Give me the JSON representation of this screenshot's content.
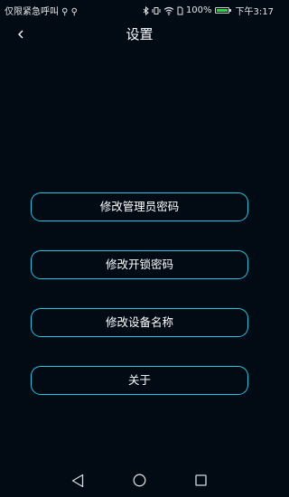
{
  "status_bar": {
    "left_text": "仅限紧急呼叫 ⚲ ⚲",
    "bluetooth_icon": "bluetooth-icon",
    "vibrate_icon": "vibrate-icon",
    "wifi_icon": "wifi-icon",
    "battery_percent": "100%",
    "battery_level": 1.0,
    "time": "下午3:17"
  },
  "header": {
    "back_icon": "chevron-left-icon",
    "title": "设置"
  },
  "menu": {
    "items": [
      {
        "label": "修改管理员密码"
      },
      {
        "label": "修改开锁密码"
      },
      {
        "label": "修改设备名称"
      },
      {
        "label": "关于"
      }
    ]
  },
  "nav_bar": {
    "back_icon": "triangle-back-icon",
    "home_icon": "circle-home-icon",
    "recent_icon": "square-recent-icon"
  },
  "colors": {
    "background": "#020a14",
    "accent_border": "#21c8e6",
    "battery_green": "#2bd24a"
  }
}
